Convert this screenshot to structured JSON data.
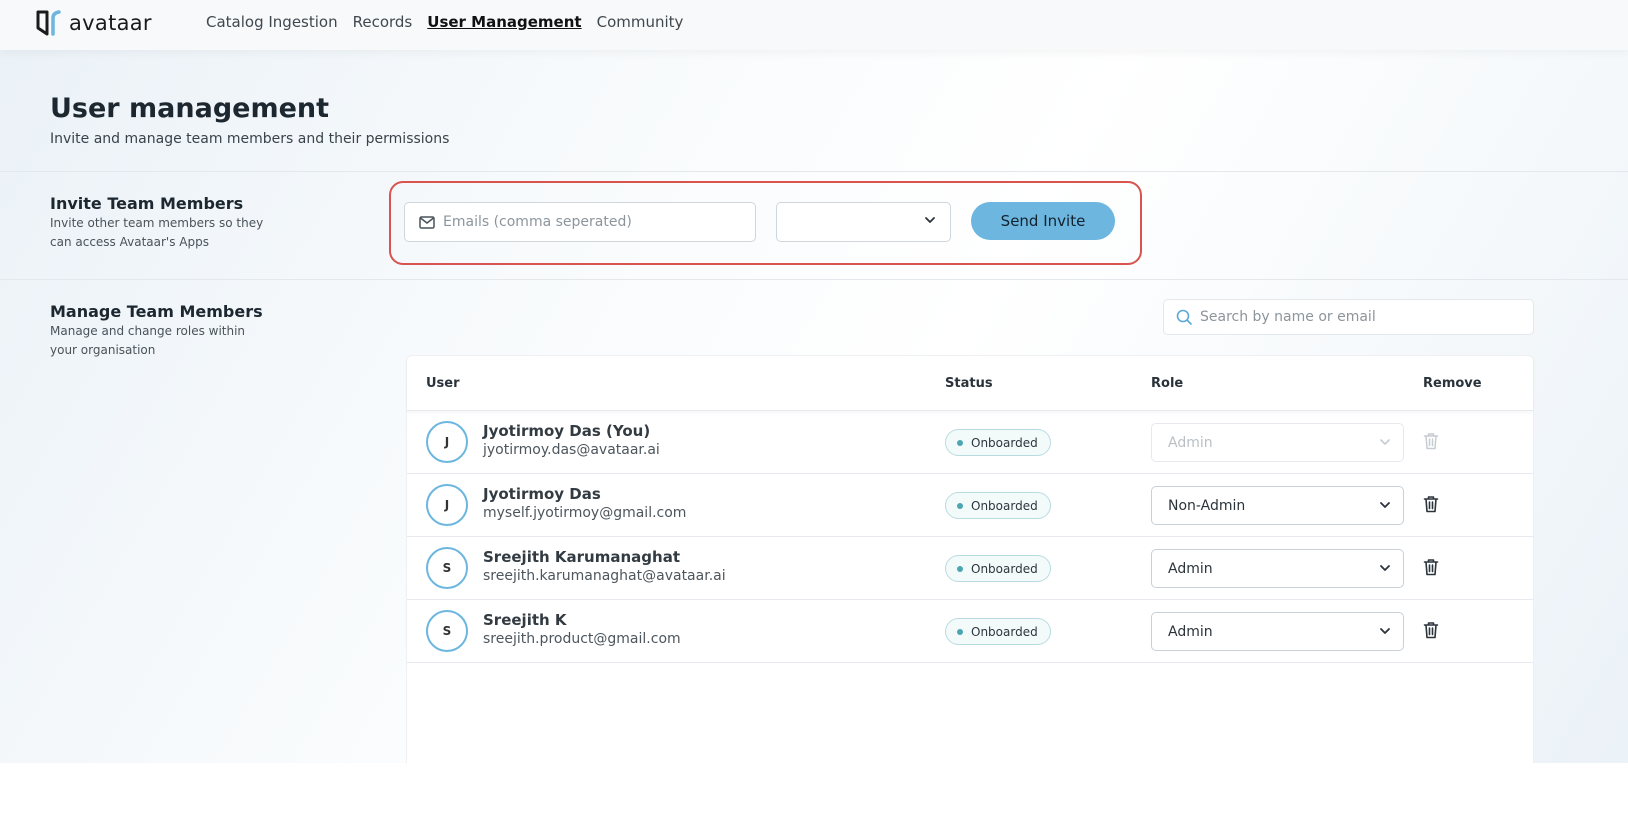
{
  "nav": {
    "logo_text": "avataar",
    "links": [
      {
        "label": "Catalog Ingestion",
        "active": false
      },
      {
        "label": "Records",
        "active": false
      },
      {
        "label": "User Management",
        "active": true
      },
      {
        "label": "Community",
        "active": false
      }
    ]
  },
  "header": {
    "title": "User management",
    "subtitle": "Invite and manage team members and their permissions"
  },
  "invite": {
    "title": "Invite Team Members",
    "description": "Invite other team members so they can access Avataar's Apps",
    "email_placeholder": "Emails (comma seperated)",
    "email_value": "",
    "role_value": "",
    "send_label": "Send Invite"
  },
  "manage": {
    "title": "Manage Team Members",
    "description": "Manage and change roles within your organisation",
    "search_placeholder": "Search by name or email"
  },
  "table": {
    "headers": {
      "user": "User",
      "status": "Status",
      "role": "Role",
      "remove": "Remove"
    },
    "rows": [
      {
        "initial": "J",
        "name": "Jyotirmoy Das (You)",
        "email": "jyotirmoy.das@avataar.ai",
        "status": "Onboarded",
        "role": "Admin",
        "role_disabled": true
      },
      {
        "initial": "J",
        "name": "Jyotirmoy Das",
        "email": "myself.jyotirmoy@gmail.com",
        "status": "Onboarded",
        "role": "Non-Admin",
        "role_disabled": false
      },
      {
        "initial": "S",
        "name": "Sreejith Karumanaghat",
        "email": "sreejith.karumanaghat@avataar.ai",
        "status": "Onboarded",
        "role": "Admin",
        "role_disabled": false
      },
      {
        "initial": "S",
        "name": "Sreejith K",
        "email": "sreejith.product@gmail.com",
        "status": "Onboarded",
        "role": "Admin",
        "role_disabled": false
      }
    ]
  },
  "colors": {
    "accent": "#6cb6df",
    "highlight_border": "#d9534f",
    "status_dot": "#4ba5b3"
  },
  "icons": {
    "email": "mail-icon",
    "search": "search-icon",
    "dropdown": "chevron-down-icon",
    "remove": "trash-icon"
  }
}
